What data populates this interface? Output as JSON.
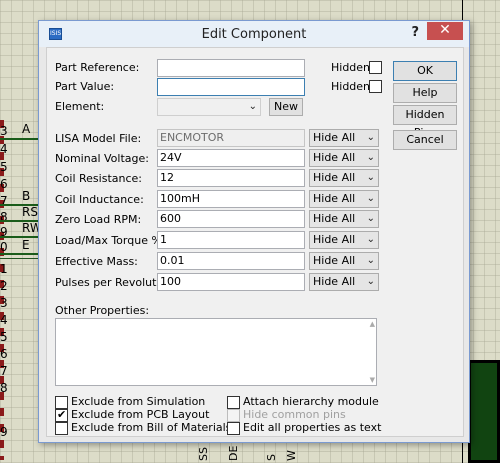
{
  "background": {
    "pin_numbers": [
      "3",
      "4",
      "5",
      "6",
      "7",
      "8",
      "9",
      "0",
      "1",
      "2",
      "3",
      "4",
      "5",
      "6",
      "7",
      "8",
      "9"
    ],
    "pin_labels": [
      "A",
      "B",
      "RS",
      "RW",
      "E"
    ],
    "bottom_texts": [
      "SS",
      "DE",
      "S",
      "W"
    ]
  },
  "dialog": {
    "title": "Edit Component",
    "app_icon": "ISIS",
    "help": "?",
    "close_icon": "✕",
    "part_reference": {
      "label": "Part Reference:",
      "value": "",
      "hidden_label": "Hidden:",
      "hidden": false
    },
    "part_value": {
      "label": "Part Value:",
      "value": "",
      "hidden_label": "Hidden:",
      "hidden": false
    },
    "element": {
      "label": "Element:",
      "value": "",
      "new_button": "New"
    },
    "fields": [
      {
        "label": "LISA Model File:",
        "value": "ENCMOTOR",
        "visibility": "Hide All",
        "disabled": true
      },
      {
        "label": "Nominal Voltage:",
        "value": "24V",
        "visibility": "Hide All"
      },
      {
        "label": "Coil Resistance:",
        "value": "12",
        "visibility": "Hide All"
      },
      {
        "label": "Coil Inductance:",
        "value": "100mH",
        "visibility": "Hide All"
      },
      {
        "label": "Zero Load RPM:",
        "value": "600",
        "visibility": "Hide All"
      },
      {
        "label": "Load/Max Torque %",
        "value": "1",
        "visibility": "Hide All"
      },
      {
        "label": "Effective Mass:",
        "value": "0.01",
        "visibility": "Hide All"
      },
      {
        "label": "Pulses per Revolution:",
        "value": "100",
        "visibility": "Hide All"
      }
    ],
    "other_properties": {
      "label": "Other Properties:",
      "value": ""
    },
    "options_left": [
      {
        "label": "Exclude from Simulation",
        "checked": false
      },
      {
        "label": "Exclude from PCB Layout",
        "checked": true
      },
      {
        "label": "Exclude from Bill of Materials",
        "checked": false
      }
    ],
    "options_right": [
      {
        "label": "Attach hierarchy module",
        "checked": false,
        "disabled": false
      },
      {
        "label": "Hide common pins",
        "checked": false,
        "disabled": true
      },
      {
        "label": "Edit all properties as text",
        "checked": false,
        "disabled": false
      }
    ],
    "buttons": {
      "ok": "OK",
      "help": "Help",
      "hidden_pins": "Hidden Pins",
      "cancel": "Cancel"
    }
  }
}
